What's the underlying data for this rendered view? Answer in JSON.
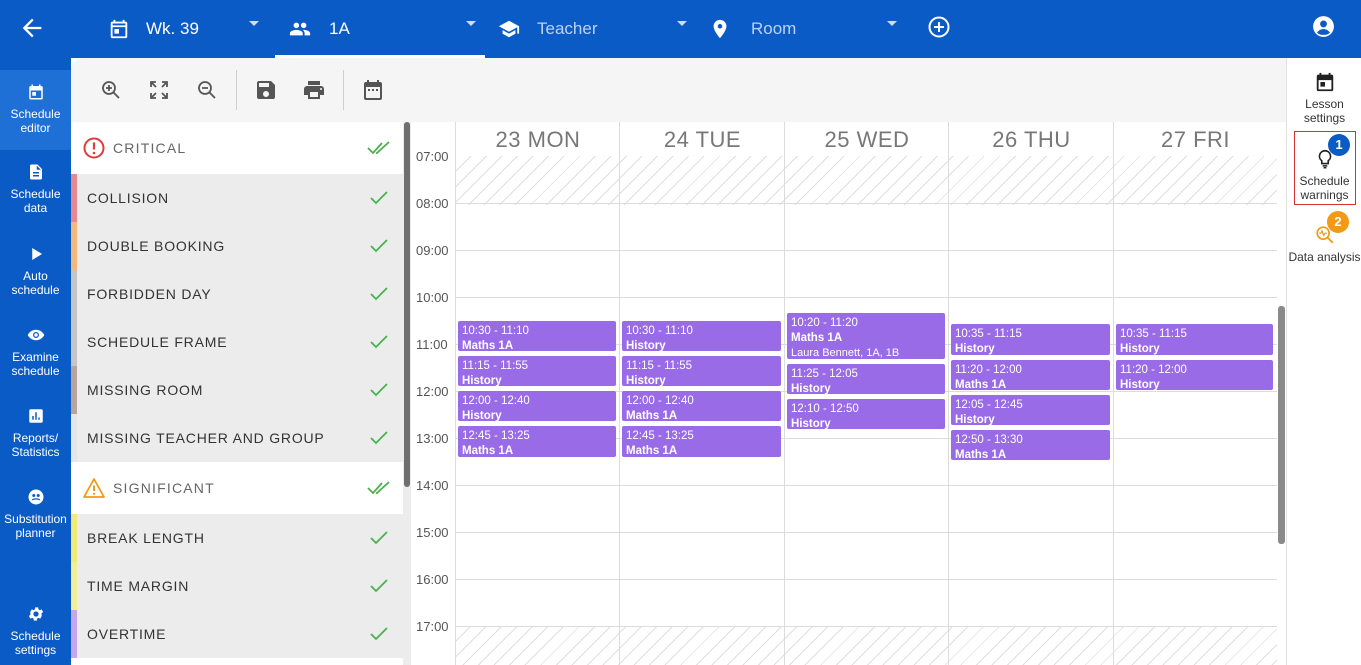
{
  "topbar": {
    "week": "Wk. 39",
    "group": "1A",
    "teacher_placeholder": "Teacher",
    "room_placeholder": "Room"
  },
  "leftnav": [
    {
      "label": "Schedule editor",
      "icon": "calendar-icon",
      "active": true
    },
    {
      "label": "Schedule data",
      "icon": "document-icon"
    },
    {
      "label": "Auto schedule",
      "icon": "play-icon"
    },
    {
      "label": "Examine schedule",
      "icon": "eye-icon"
    },
    {
      "label": "Reports/ Statistics",
      "icon": "bar-chart-icon"
    },
    {
      "label": "Substitution planner",
      "icon": "substitution-icon"
    },
    {
      "label": "Schedule settings",
      "icon": "gear-icon"
    }
  ],
  "toolbar": [
    "zoom-in-icon",
    "fit-screen-icon",
    "zoom-out-icon",
    "save-icon",
    "print-icon",
    "calendar-icon"
  ],
  "warnings": {
    "critical": {
      "title": "CRITICAL",
      "items": [
        {
          "label": "COLLISION",
          "color": "#e9888f"
        },
        {
          "label": "DOUBLE BOOKING",
          "color": "#f6b77a"
        },
        {
          "label": "FORBIDDEN DAY",
          "color": "#c5c5c5"
        },
        {
          "label": "SCHEDULE FRAME",
          "color": "#c5c5c5"
        },
        {
          "label": "MISSING ROOM",
          "color": "#b8a49a"
        },
        {
          "label": "MISSING TEACHER AND GROUP",
          "color": "#e6e6e6"
        }
      ]
    },
    "significant": {
      "title": "SIGNIFICANT",
      "items": [
        {
          "label": "BREAK LENGTH",
          "color": "#f1ea74"
        },
        {
          "label": "TIME MARGIN",
          "color": "#f1ee96"
        },
        {
          "label": "OVERTIME",
          "color": "#c7a6ee"
        }
      ]
    }
  },
  "calendar": {
    "days": [
      "23 MON",
      "24 TUE",
      "25 WED",
      "26 THU",
      "27 FRI"
    ],
    "hours": [
      "07:00",
      "08:00",
      "09:00",
      "10:00",
      "11:00",
      "12:00",
      "13:00",
      "14:00",
      "15:00",
      "16:00",
      "17:00"
    ],
    "lesson_color": "#9a6be7",
    "lessons": [
      {
        "day": 0,
        "time": "10:30 - 11:10",
        "subject": "Maths 1A",
        "start": "10:30",
        "end": "11:10"
      },
      {
        "day": 0,
        "time": "11:15 - 11:55",
        "subject": "History",
        "start": "11:15",
        "end": "11:55"
      },
      {
        "day": 0,
        "time": "12:00 - 12:40",
        "subject": "History",
        "start": "12:00",
        "end": "12:40"
      },
      {
        "day": 0,
        "time": "12:45 - 13:25",
        "subject": "Maths 1A",
        "start": "12:45",
        "end": "13:25"
      },
      {
        "day": 1,
        "time": "10:30 - 11:10",
        "subject": "History",
        "start": "10:30",
        "end": "11:10"
      },
      {
        "day": 1,
        "time": "11:15 - 11:55",
        "subject": "History",
        "start": "11:15",
        "end": "11:55"
      },
      {
        "day": 1,
        "time": "12:00 - 12:40",
        "subject": "Maths 1A",
        "start": "12:00",
        "end": "12:40"
      },
      {
        "day": 1,
        "time": "12:45 - 13:25",
        "subject": "Maths 1A",
        "start": "12:45",
        "end": "13:25"
      },
      {
        "day": 2,
        "time": "10:20 - 11:20",
        "subject": "Maths 1A",
        "extra": "Laura Bennett, 1A, 1B",
        "start": "10:20",
        "end": "11:20"
      },
      {
        "day": 2,
        "time": "11:25 - 12:05",
        "subject": "History",
        "start": "11:25",
        "end": "12:05"
      },
      {
        "day": 2,
        "time": "12:10 - 12:50",
        "subject": "History",
        "start": "12:10",
        "end": "12:50"
      },
      {
        "day": 3,
        "time": "10:35 - 11:15",
        "subject": "History",
        "start": "10:35",
        "end": "11:15"
      },
      {
        "day": 3,
        "time": "11:20 - 12:00",
        "subject": "Maths 1A",
        "start": "11:20",
        "end": "12:00"
      },
      {
        "day": 3,
        "time": "12:05 - 12:45",
        "subject": "History",
        "start": "12:05",
        "end": "12:45"
      },
      {
        "day": 3,
        "time": "12:50 - 13:30",
        "subject": "Maths 1A",
        "start": "12:50",
        "end": "13:30"
      },
      {
        "day": 4,
        "time": "10:35 - 11:15",
        "subject": "History",
        "start": "10:35",
        "end": "11:15"
      },
      {
        "day": 4,
        "time": "11:20 - 12:00",
        "subject": "History",
        "start": "11:20",
        "end": "12:00"
      }
    ]
  },
  "rightpanel": [
    {
      "label": "Lesson settings",
      "icon": "calendar-icon"
    },
    {
      "label": "Schedule warnings",
      "icon": "lightbulb-icon",
      "badge": "1",
      "badge_color": "#0b5bc7",
      "selected": true
    },
    {
      "label": "Data analysis",
      "icon": "analysis-icon",
      "badge": "2",
      "badge_color": "#f29a16"
    }
  ]
}
